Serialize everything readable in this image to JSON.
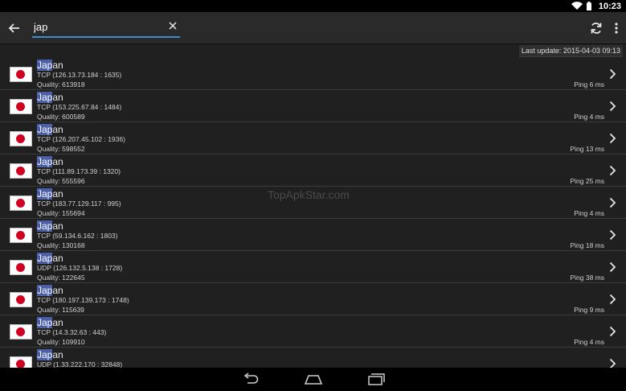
{
  "status_bar": {
    "time": "10:23"
  },
  "search": {
    "value": "jap",
    "highlight": "Jap"
  },
  "last_update": "Last update: 2015-04-03 09:13",
  "watermark": "TopApkStar.com",
  "servers": [
    {
      "country_rest": "an",
      "protocol": "TCP (126.13.73.184 : 1635)",
      "quality": "Quality: 613918",
      "ping": "Ping 6 ms"
    },
    {
      "country_rest": "an",
      "protocol": "TCP (153.225.67.84 : 1484)",
      "quality": "Quality: 600589",
      "ping": "Ping 4 ms"
    },
    {
      "country_rest": "an",
      "protocol": "TCP (126.207.45.102 : 1936)",
      "quality": "Quality: 598552",
      "ping": "Ping 13 ms"
    },
    {
      "country_rest": "an",
      "protocol": "TCP (111.89.173.39 : 1320)",
      "quality": "Quality: 555596",
      "ping": "Ping 25 ms"
    },
    {
      "country_rest": "an",
      "protocol": "TCP (183.77.129.117 : 995)",
      "quality": "Quality: 155694",
      "ping": "Ping 4 ms"
    },
    {
      "country_rest": "an",
      "protocol": "TCP (59.134.6.162 : 1803)",
      "quality": "Quality: 130168",
      "ping": "Ping 18 ms"
    },
    {
      "country_rest": "an",
      "protocol": "UDP (126.132.5.138 : 1728)",
      "quality": "Quality: 122645",
      "ping": "Ping 38 ms"
    },
    {
      "country_rest": "an",
      "protocol": "TCP (180.197.139.173 : 1748)",
      "quality": "Quality: 115639",
      "ping": "Ping 9 ms"
    },
    {
      "country_rest": "an",
      "protocol": "TCP (14.3.32.63 : 443)",
      "quality": "Quality: 109910",
      "ping": "Ping 4 ms"
    },
    {
      "country_rest": "an",
      "protocol": "UDP (1.33.222.170 : 32848)",
      "quality": "",
      "ping": ""
    }
  ]
}
